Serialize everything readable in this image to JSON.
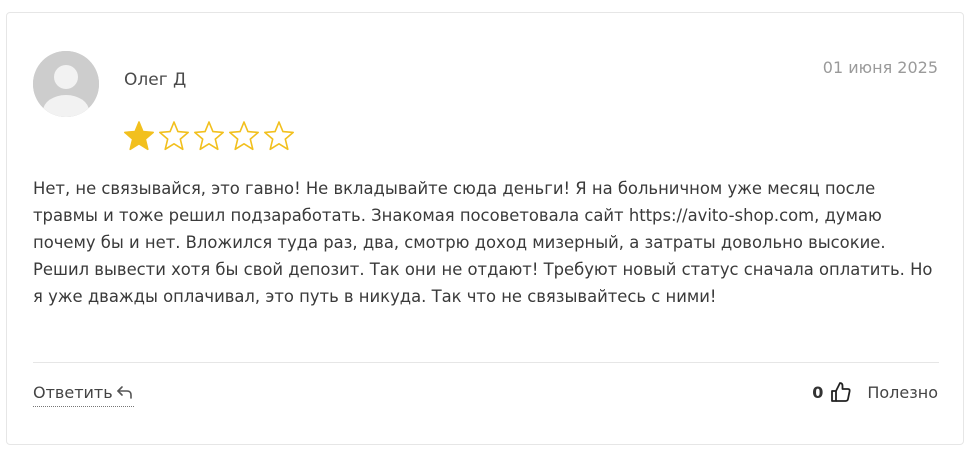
{
  "review": {
    "author": "Олег Д",
    "date": "01 июня 2025",
    "rating": 1,
    "max_rating": 5,
    "star_color": "#f2c01e",
    "text": "Нет, не связывайся, это гавно! Не вкладывайте сюда деньги! Я на больничном уже месяц после травмы и тоже решил подзаработать. Знакомая посоветовала сайт https://avito-shop.com, думаю почему бы и нет. Вложился туда раз, два, смотрю доход мизерный, а затраты довольно высокие. Решил вывести хотя бы свой депозит. Так они не отдают! Требуют новый статус сначала оплатить. Но я уже дважды оплачивал, это путь в никуда. Так что не связывайтесь с ними!"
  },
  "actions": {
    "reply_label": "Ответить",
    "reply_icon": "reply-arrow-icon",
    "helpful_count": "0",
    "helpful_icon": "thumbs-up-icon",
    "helpful_label": "Полезно"
  }
}
